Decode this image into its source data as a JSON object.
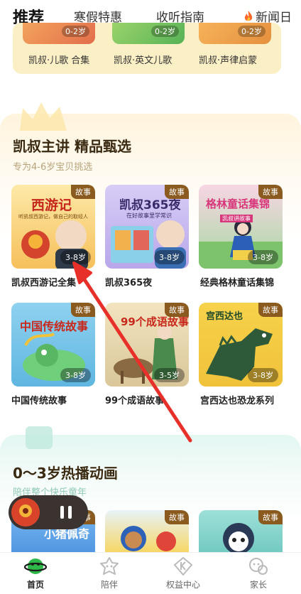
{
  "top_tabs": [
    {
      "label": "推荐",
      "active": true
    },
    {
      "label": "寒假特惠",
      "active": false
    },
    {
      "label": "收听指南",
      "active": false
    },
    {
      "label": "新闻日",
      "active": false
    }
  ],
  "top_strip": {
    "items": [
      {
        "label": "凯叔·儿歌 合集",
        "age": "0-2岁"
      },
      {
        "label": "凯叔·英文儿歌",
        "age": "0-2岁"
      },
      {
        "label": "凯叔·声律启蒙",
        "age": "0-2岁"
      }
    ]
  },
  "section1": {
    "title": "凯叔主讲 精品甄选",
    "subtitle": "专为4-6岁宝贝挑选",
    "cards": [
      {
        "title": "凯叔西游记全集",
        "badge": "故事",
        "age": "3-8岁",
        "cover_text": "西游记",
        "cover_sub": "听凯叔西游记，做自己的取经人"
      },
      {
        "title": "凯叔365夜",
        "badge": "故事",
        "age": "3-8岁",
        "cover_text": "凯叔365夜",
        "cover_sub": "在好故事里学常识"
      },
      {
        "title": "经典格林童话集锦",
        "badge": "故事",
        "age": "3-8岁",
        "cover_text": "格林童话集锦",
        "cover_sub": "凯叔讲故事"
      },
      {
        "title": "中国传统故事",
        "badge": "故事",
        "age": "3-8岁",
        "cover_text": "中国传统故事"
      },
      {
        "title": "99个成语故事",
        "badge": "故事",
        "age": "3-5岁",
        "cover_text": "99个成语故事"
      },
      {
        "title": "宫西达也恐龙系列",
        "badge": "故事",
        "age": "3-8岁",
        "cover_text": "宫西达也"
      }
    ]
  },
  "section2": {
    "title": "0～3岁热播动画",
    "subtitle": "陪伴整个快乐童年",
    "cards": [
      {
        "badge": "故事",
        "cover_text": "小猪佩奇"
      },
      {
        "badge": "故事"
      },
      {
        "badge": "故事"
      }
    ]
  },
  "bottom_nav": [
    {
      "label": "首页",
      "icon": "planet-icon",
      "active": true
    },
    {
      "label": "陪伴",
      "icon": "companion-icon",
      "active": false
    },
    {
      "label": "权益中心",
      "icon": "benefits-icon",
      "active": false
    },
    {
      "label": "家长",
      "icon": "parent-icon",
      "active": false
    }
  ],
  "colors": {
    "badge": "#8a5a1e",
    "section1_title": "#3b2a12",
    "annotation_arrow": "#e8302a"
  }
}
